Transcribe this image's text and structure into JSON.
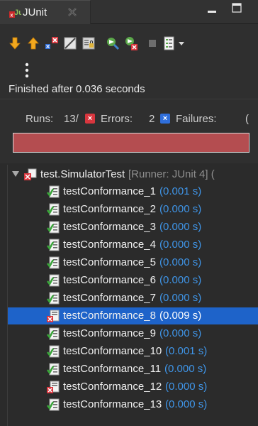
{
  "tab": {
    "title": "JUnit"
  },
  "toolbar": {
    "buttons": [
      {
        "name": "next-failure",
        "icon": "arrow-down-icon"
      },
      {
        "name": "previous-failure",
        "icon": "arrow-up-icon"
      },
      {
        "name": "show-failures-only",
        "icon": "failures-filter-icon"
      },
      {
        "name": "show-skipped",
        "icon": "skipped-icon"
      },
      {
        "name": "scroll-lock",
        "icon": "scroll-lock-icon"
      },
      {
        "name": "rerun",
        "icon": "rerun-icon"
      },
      {
        "name": "rerun-failed-first",
        "icon": "rerun-failed-icon"
      },
      {
        "name": "stop",
        "icon": "stop-icon"
      },
      {
        "name": "history",
        "icon": "history-icon"
      }
    ]
  },
  "status": {
    "text": "Finished after 0.036 seconds"
  },
  "counters": {
    "runs_label": "Runs:",
    "runs_value": "13/",
    "errors_label": "Errors:",
    "errors_value": "2",
    "failures_label": "Failures:",
    "failures_value": "("
  },
  "colors": {
    "progress": "#b44d50",
    "error": "#d9363e",
    "failure": "#2f6fdc",
    "selection": "#1e63c9",
    "time": "#3f95e8"
  },
  "tree": {
    "suite": {
      "name": "test.SimulatorTest",
      "runner": "[Runner: JUnit 4] ("
    },
    "tests": [
      {
        "name": "testConformance_1",
        "time": "(0.001 s)",
        "status": "passed"
      },
      {
        "name": "testConformance_2",
        "time": "(0.000 s)",
        "status": "passed"
      },
      {
        "name": "testConformance_3",
        "time": "(0.000 s)",
        "status": "passed"
      },
      {
        "name": "testConformance_4",
        "time": "(0.000 s)",
        "status": "passed"
      },
      {
        "name": "testConformance_5",
        "time": "(0.000 s)",
        "status": "passed"
      },
      {
        "name": "testConformance_6",
        "time": "(0.000 s)",
        "status": "passed"
      },
      {
        "name": "testConformance_7",
        "time": "(0.000 s)",
        "status": "passed"
      },
      {
        "name": "testConformance_8",
        "time": "(0.009 s)",
        "status": "error",
        "selected": true
      },
      {
        "name": "testConformance_9",
        "time": "(0.000 s)",
        "status": "passed"
      },
      {
        "name": "testConformance_10",
        "time": "(0.001 s)",
        "status": "passed"
      },
      {
        "name": "testConformance_11",
        "time": "(0.000 s)",
        "status": "passed"
      },
      {
        "name": "testConformance_12",
        "time": "(0.000 s)",
        "status": "error"
      },
      {
        "name": "testConformance_13",
        "time": "(0.000 s)",
        "status": "passed"
      }
    ]
  }
}
